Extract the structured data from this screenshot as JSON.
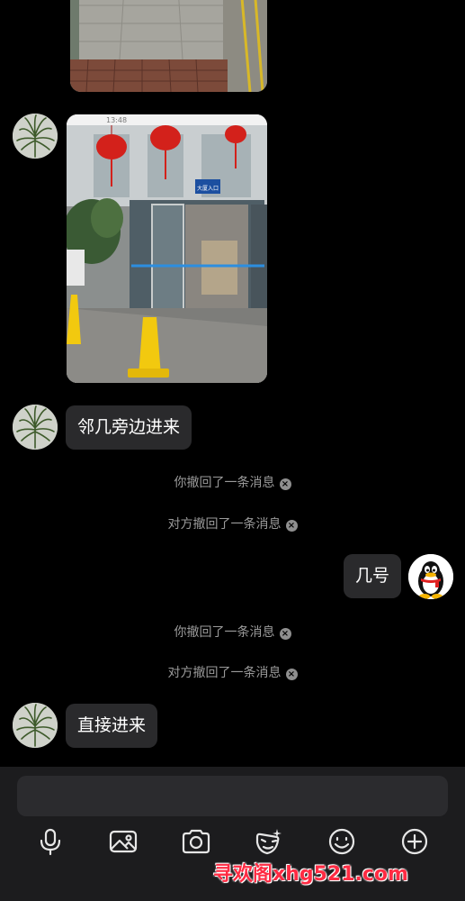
{
  "messages": {
    "msg1": "邻几旁边进来",
    "recall1": "你撤回了一条消息",
    "recall2": "对方撤回了一条消息",
    "msg_self": "几号",
    "recall3": "你撤回了一条消息",
    "recall4": "对方撤回了一条消息",
    "msg2": "直接进来"
  },
  "photo_timestamp": "13:48",
  "photo_sign": "大厦入口",
  "toolbar": {
    "icons": [
      "microphone-icon",
      "image-icon",
      "camera-icon",
      "sticker-icon",
      "emoji-icon",
      "plus-icon"
    ]
  },
  "watermark": "寻欢阁xhg521.com",
  "colors": {
    "background": "#000000",
    "bubble": "#2a2a2c",
    "system_text": "#9a9a9a",
    "bottom_bar": "#1c1c1e",
    "watermark": "#ff2b43"
  }
}
